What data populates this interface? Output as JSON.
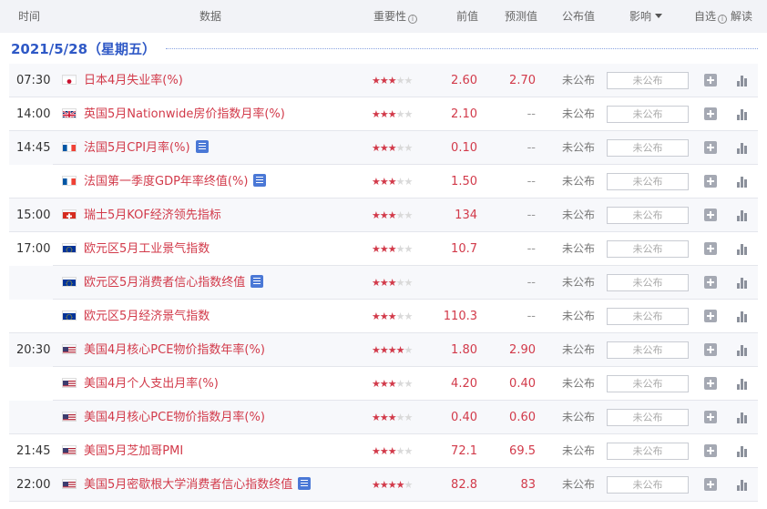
{
  "header": {
    "time": "时间",
    "data": "数据",
    "importance": "重要性",
    "previous": "前值",
    "forecast": "预测值",
    "published": "公布值",
    "impact": "影响",
    "custom": "自选",
    "interpret": "解读",
    "info_glyph": "i"
  },
  "date_label": "2021/5/28（星期五）",
  "colors": {
    "accent_red": "#d23a4a",
    "accent_blue": "#2f59c6",
    "star_off": "#d9d9d9"
  },
  "rows": [
    {
      "time": "07:30",
      "flag": "japan-flag",
      "name": "日本4月失业率(%)",
      "doc": false,
      "stars": 3,
      "prev": "2.60",
      "forecast": "2.70",
      "pub": "未公布",
      "impact": "未公布"
    },
    {
      "time": "14:00",
      "flag": "uk-flag",
      "name": "英国5月Nationwide房价指数月率(%)",
      "doc": false,
      "stars": 3,
      "prev": "2.10",
      "forecast": "--",
      "pub": "未公布",
      "impact": "未公布"
    },
    {
      "time": "14:45",
      "flag": "france-flag",
      "name": "法国5月CPI月率(%)",
      "doc": true,
      "stars": 3,
      "prev": "0.10",
      "forecast": "--",
      "pub": "未公布",
      "impact": "未公布"
    },
    {
      "time": "",
      "flag": "france-flag",
      "name": "法国第一季度GDP年率终值(%)",
      "doc": true,
      "stars": 3,
      "prev": "1.50",
      "forecast": "--",
      "pub": "未公布",
      "impact": "未公布"
    },
    {
      "time": "15:00",
      "flag": "switzerland-flag",
      "name": "瑞士5月KOF经济领先指标",
      "doc": false,
      "stars": 3,
      "prev": "134",
      "forecast": "--",
      "pub": "未公布",
      "impact": "未公布"
    },
    {
      "time": "17:00",
      "flag": "eu-flag",
      "name": "欧元区5月工业景气指数",
      "doc": false,
      "stars": 3,
      "prev": "10.7",
      "forecast": "--",
      "pub": "未公布",
      "impact": "未公布"
    },
    {
      "time": "",
      "flag": "eu-flag",
      "name": "欧元区5月消费者信心指数终值",
      "doc": true,
      "stars": 3,
      "prev": "",
      "forecast": "--",
      "pub": "未公布",
      "impact": "未公布"
    },
    {
      "time": "",
      "flag": "eu-flag",
      "name": "欧元区5月经济景气指数",
      "doc": false,
      "stars": 3,
      "prev": "110.3",
      "forecast": "--",
      "pub": "未公布",
      "impact": "未公布"
    },
    {
      "time": "20:30",
      "flag": "us-flag",
      "name": "美国4月核心PCE物价指数年率(%)",
      "doc": false,
      "stars": 4,
      "prev": "1.80",
      "forecast": "2.90",
      "pub": "未公布",
      "impact": "未公布"
    },
    {
      "time": "",
      "flag": "us-flag",
      "name": "美国4月个人支出月率(%)",
      "doc": false,
      "stars": 3,
      "prev": "4.20",
      "forecast": "0.40",
      "pub": "未公布",
      "impact": "未公布"
    },
    {
      "time": "",
      "flag": "us-flag",
      "name": "美国4月核心PCE物价指数月率(%)",
      "doc": false,
      "stars": 3,
      "prev": "0.40",
      "forecast": "0.60",
      "pub": "未公布",
      "impact": "未公布"
    },
    {
      "time": "21:45",
      "flag": "us-flag",
      "name": "美国5月芝加哥PMI",
      "doc": false,
      "stars": 3,
      "prev": "72.1",
      "forecast": "69.5",
      "pub": "未公布",
      "impact": "未公布"
    },
    {
      "time": "22:00",
      "flag": "us-flag",
      "name": "美国5月密歇根大学消费者信心指数终值",
      "doc": true,
      "stars": 4,
      "prev": "82.8",
      "forecast": "83",
      "pub": "未公布",
      "impact": "未公布"
    }
  ]
}
